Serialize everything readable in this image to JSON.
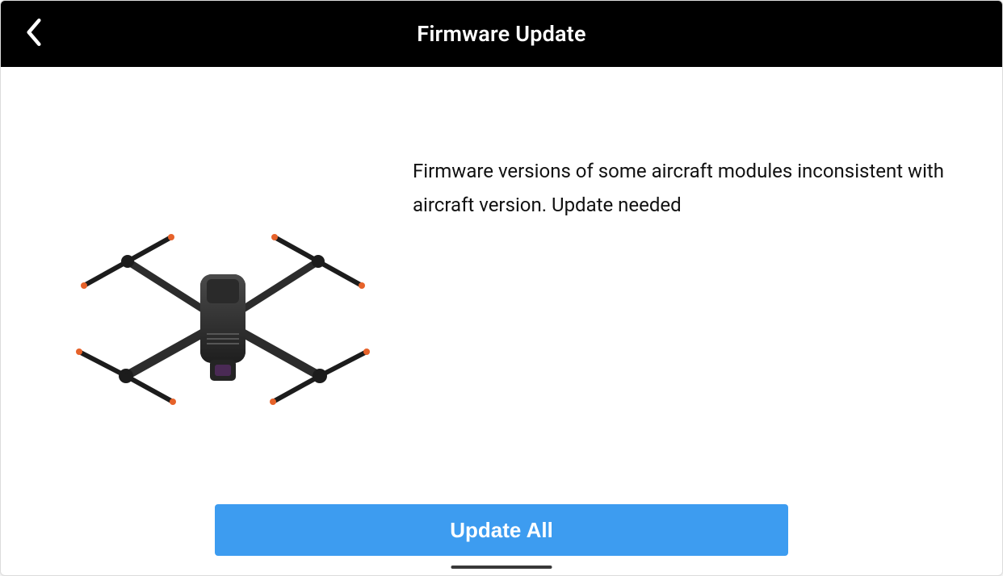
{
  "header": {
    "title": "Firmware Update"
  },
  "content": {
    "message": "Firmware versions of some aircraft modules inconsistent with aircraft version. Update needed"
  },
  "actions": {
    "update_all_label": "Update All"
  },
  "icons": {
    "back": "chevron-left"
  },
  "colors": {
    "primary": "#3d9cf0",
    "header_bg": "#000000",
    "text": "#111111"
  }
}
